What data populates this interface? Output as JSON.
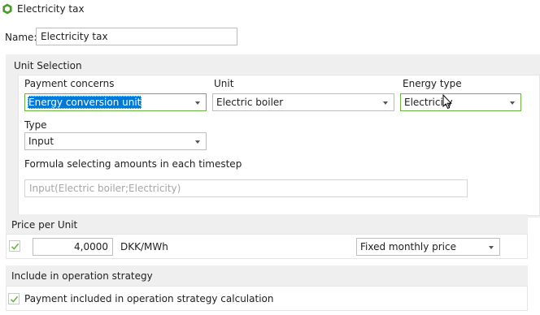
{
  "window": {
    "title": "Electricity tax",
    "icon": "app-logo-icon"
  },
  "name_field": {
    "label": "Name:",
    "value": "Electricity tax"
  },
  "unit_selection": {
    "header": "Unit Selection",
    "payment_concerns": {
      "label": "Payment concerns",
      "value": "Energy conversion unit"
    },
    "unit": {
      "label": "Unit",
      "value": "Electric boiler"
    },
    "energy_type": {
      "label": "Energy type",
      "value": "Electricity"
    },
    "type": {
      "label": "Type",
      "value": "Input"
    },
    "formula": {
      "label": "Formula selecting amounts in each timestep",
      "value": "Input(Electric boiler;Electricity)"
    }
  },
  "price_per_unit": {
    "header": "Price per Unit",
    "checked": true,
    "amount": "4,0000",
    "unit": "DKK/MWh",
    "pricing": "Fixed monthly price"
  },
  "operation_strategy": {
    "header": "Include in operation strategy",
    "checked": true,
    "checkbox_label": "Payment included in operation strategy calculation"
  },
  "colors": {
    "accent_green": "#6bb342",
    "selection_blue": "#0078d7",
    "section_band": "#efefef"
  }
}
